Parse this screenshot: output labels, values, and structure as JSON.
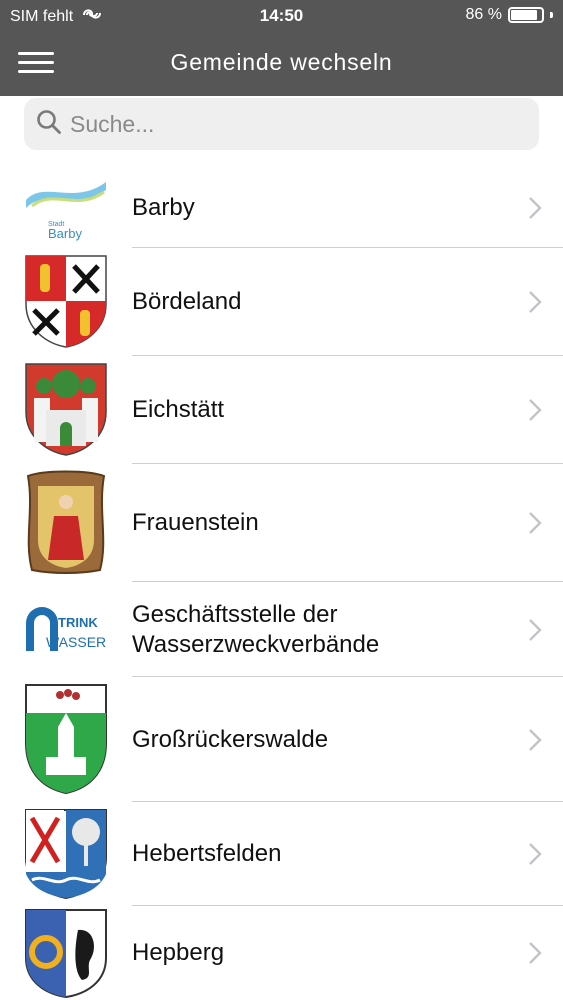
{
  "status_bar": {
    "carrier": "SIM fehlt",
    "time": "14:50",
    "battery_text": "86 %",
    "battery_level": 0.86
  },
  "header": {
    "title": "Gemeinde wechseln"
  },
  "search": {
    "placeholder": "Suche..."
  },
  "items": [
    {
      "label": "Barby",
      "logo_caption_small": "Stadt",
      "logo_caption": "Barby",
      "icon": "barby-logo"
    },
    {
      "label": "Bördeland",
      "icon": "boerdeland-coat-of-arms"
    },
    {
      "label": "Eichstätt",
      "icon": "eichstaett-coat-of-arms"
    },
    {
      "label": "Frauenstein",
      "icon": "frauenstein-coat-of-arms"
    },
    {
      "label": "Geschäftsstelle der Wasserzweckverbände",
      "logo_caption": "TRINK",
      "logo_caption_2": "WASSER",
      "icon": "trinkwasser-logo"
    },
    {
      "label": "Großrückerswalde",
      "icon": "grossrueckerswalde-coat-of-arms"
    },
    {
      "label": "Hebertsfelden",
      "icon": "hebertsfelden-coat-of-arms"
    },
    {
      "label": "Hepberg",
      "icon": "hepberg-coat-of-arms"
    }
  ],
  "colors": {
    "header_bg": "#565656",
    "search_bg": "#efefef",
    "separator": "#cfcfcf",
    "chevron": "#c4c4c8"
  }
}
